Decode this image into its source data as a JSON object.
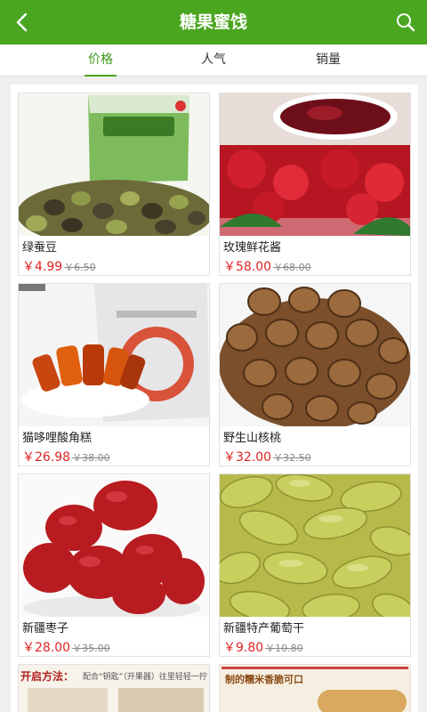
{
  "header": {
    "title": "糖果蜜饯",
    "back_icon": "chevron-left-icon",
    "search_icon": "search-icon",
    "color": "#4aa51f"
  },
  "tabs": [
    {
      "label": "价格",
      "active": true
    },
    {
      "label": "人气",
      "active": false
    },
    {
      "label": "销量",
      "active": false
    }
  ],
  "products": [
    {
      "name": "绿蚕豆",
      "price": "￥4.99",
      "old_price": "￥6.50"
    },
    {
      "name": "玫瑰鲜花酱",
      "price": "￥58.00",
      "old_price": "￥68.00"
    },
    {
      "name": "猫哆哩酸角糕",
      "price": "￥26.98",
      "old_price": "￥38.00"
    },
    {
      "name": "野生山核桃",
      "price": "￥32.00",
      "old_price": "￥32.50"
    },
    {
      "name": "新疆枣子",
      "price": "￥28.00",
      "old_price": "￥35.00"
    },
    {
      "name": "新疆特产葡萄干",
      "price": "￥9.80",
      "old_price": "￥10.80"
    }
  ],
  "partial": [
    {
      "caption": "开启方法：",
      "subcaption": "配合“钥匙”（开果器）往里轻轻一拧"
    },
    {
      "caption": "制的糯米香脆可口"
    }
  ]
}
